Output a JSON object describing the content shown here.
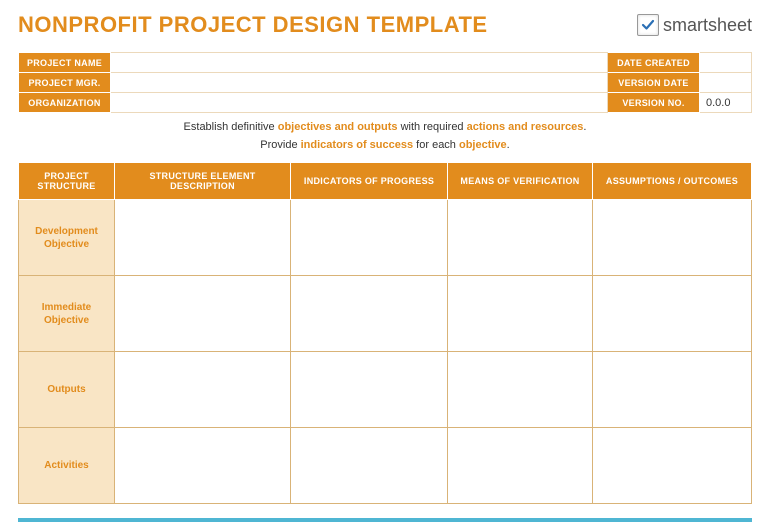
{
  "header": {
    "title": "NONPROFIT PROJECT DESIGN TEMPLATE",
    "logo_text": "smartsheet"
  },
  "meta": {
    "labels": {
      "project_name": "PROJECT NAME",
      "project_mgr": "PROJECT MGR.",
      "organization": "ORGANIZATION",
      "date_created": "DATE CREATED",
      "version_date": "VERSION DATE",
      "version_no": "VERSION NO."
    },
    "values": {
      "project_name": "",
      "project_mgr": "",
      "organization": "",
      "date_created": "",
      "version_date": "",
      "version_no": "0.0.0"
    }
  },
  "instructions": {
    "line1_a": "Establish definitive ",
    "line1_b": "objectives and outputs",
    "line1_c": " with required ",
    "line1_d": "actions and resources",
    "line1_e": ".",
    "line2_a": "Provide ",
    "line2_b": "indicators of success",
    "line2_c": " for each ",
    "line2_d": "objective",
    "line2_e": "."
  },
  "grid": {
    "headers": {
      "c1": "PROJECT STRUCTURE",
      "c2": "STRUCTURE ELEMENT DESCRIPTION",
      "c3": "INDICATORS OF PROGRESS",
      "c4": "MEANS OF VERIFICATION",
      "c5": "ASSUMPTIONS / OUTCOMES"
    },
    "rows": [
      {
        "label": "Development Objective",
        "c2": "",
        "c3": "",
        "c4": "",
        "c5": ""
      },
      {
        "label": "Immediate Objective",
        "c2": "",
        "c3": "",
        "c4": "",
        "c5": ""
      },
      {
        "label": "Outputs",
        "c2": "",
        "c3": "",
        "c4": "",
        "c5": ""
      },
      {
        "label": "Activities",
        "c2": "",
        "c3": "",
        "c4": "",
        "c5": ""
      }
    ]
  }
}
